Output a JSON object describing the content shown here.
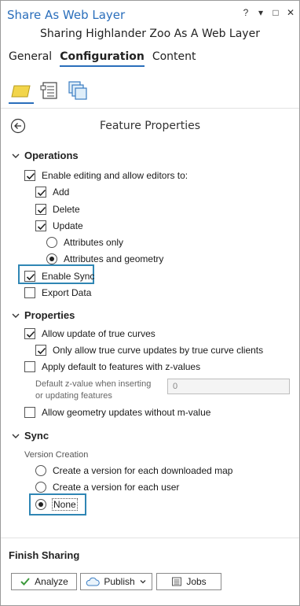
{
  "window": {
    "title": "Share As Web Layer",
    "controls": {
      "help": "?",
      "menu": "▾",
      "restore": "□",
      "close": "✕"
    },
    "subtitle": "Sharing Highlander Zoo As A Web Layer"
  },
  "tabs": [
    {
      "label": "General",
      "active": false
    },
    {
      "label": "Configuration",
      "active": true
    },
    {
      "label": "Content",
      "active": false
    }
  ],
  "panel": {
    "title": "Feature Properties"
  },
  "operations": {
    "heading": "Operations",
    "enable_editing": {
      "label": "Enable editing and allow editors to:",
      "checked": true
    },
    "add": {
      "label": "Add",
      "checked": true
    },
    "delete": {
      "label": "Delete",
      "checked": true
    },
    "update": {
      "label": "Update",
      "checked": true
    },
    "attributes_only": {
      "label": "Attributes only",
      "selected": false
    },
    "attributes_geometry": {
      "label": "Attributes and geometry",
      "selected": true
    },
    "enable_sync": {
      "label": "Enable Sync",
      "checked": true
    },
    "export_data": {
      "label": "Export Data",
      "checked": false
    }
  },
  "properties": {
    "heading": "Properties",
    "true_curves": {
      "label": "Allow update of true curves",
      "checked": true
    },
    "true_curve_clients": {
      "label": "Only allow true curve updates by true curve clients",
      "checked": true
    },
    "z_default": {
      "label": "Apply default to features with z-values",
      "checked": false
    },
    "z_value_label_1": "Default z-value when inserting",
    "z_value_label_2": "or updating features",
    "z_value": "0",
    "m_value": {
      "label": "Allow geometry updates without m-value",
      "checked": false
    }
  },
  "sync": {
    "heading": "Sync",
    "version_creation_label": "Version Creation",
    "per_map": {
      "label": "Create a version for each downloaded map",
      "selected": false
    },
    "per_user": {
      "label": "Create a version for each user",
      "selected": false
    },
    "none": {
      "label": "None",
      "selected": true
    }
  },
  "finish": {
    "heading": "Finish Sharing",
    "analyze": "Analyze",
    "publish": "Publish",
    "jobs": "Jobs"
  },
  "colors": {
    "accent": "#2a6ebb",
    "highlight": "#2f86b4"
  }
}
